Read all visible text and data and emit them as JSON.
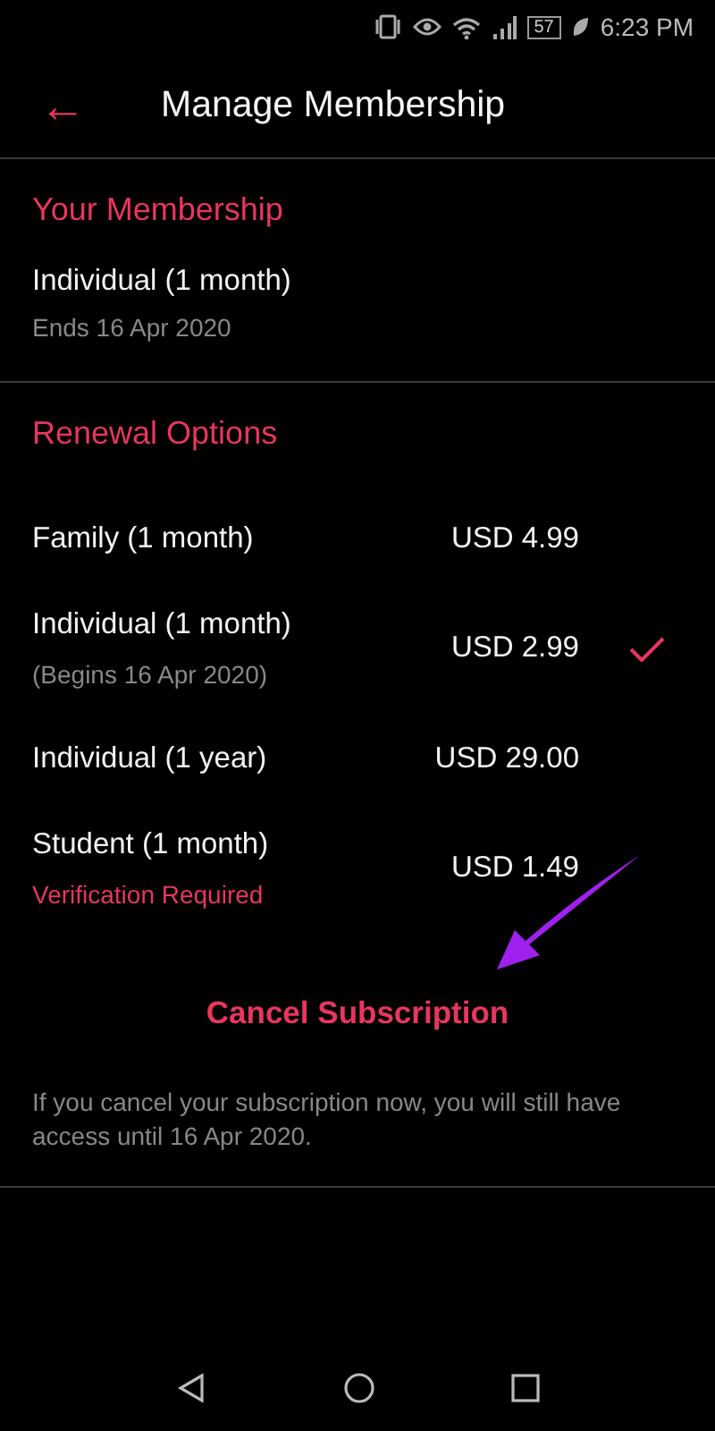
{
  "status_bar": {
    "battery": "57",
    "time": "6:23 PM"
  },
  "app_bar": {
    "back_icon": "←",
    "title": "Manage Membership"
  },
  "your_membership": {
    "heading": "Your Membership",
    "plan": "Individual (1 month)",
    "ends": "Ends 16 Apr 2020"
  },
  "renewal_options": {
    "heading": "Renewal Options",
    "plans": [
      {
        "kind": "plain",
        "name": "Family (1 month)",
        "price": "USD 4.99",
        "selected": false
      },
      {
        "kind": "dated",
        "name": "Individual (1 month)",
        "note": "(Begins 16 Apr 2020)",
        "price": "USD 2.99",
        "selected": true
      },
      {
        "kind": "plain",
        "name": "Individual (1 year)",
        "price": "USD 29.00",
        "selected": false
      },
      {
        "kind": "verification",
        "name": "Student (1 month)",
        "note": "Verification Required",
        "price": "USD 1.49",
        "selected": false
      }
    ]
  },
  "cancel_button": "Cancel Subscription",
  "info_text": "If you cancel your subscription now, you will still have access until 16 Apr 2020."
}
